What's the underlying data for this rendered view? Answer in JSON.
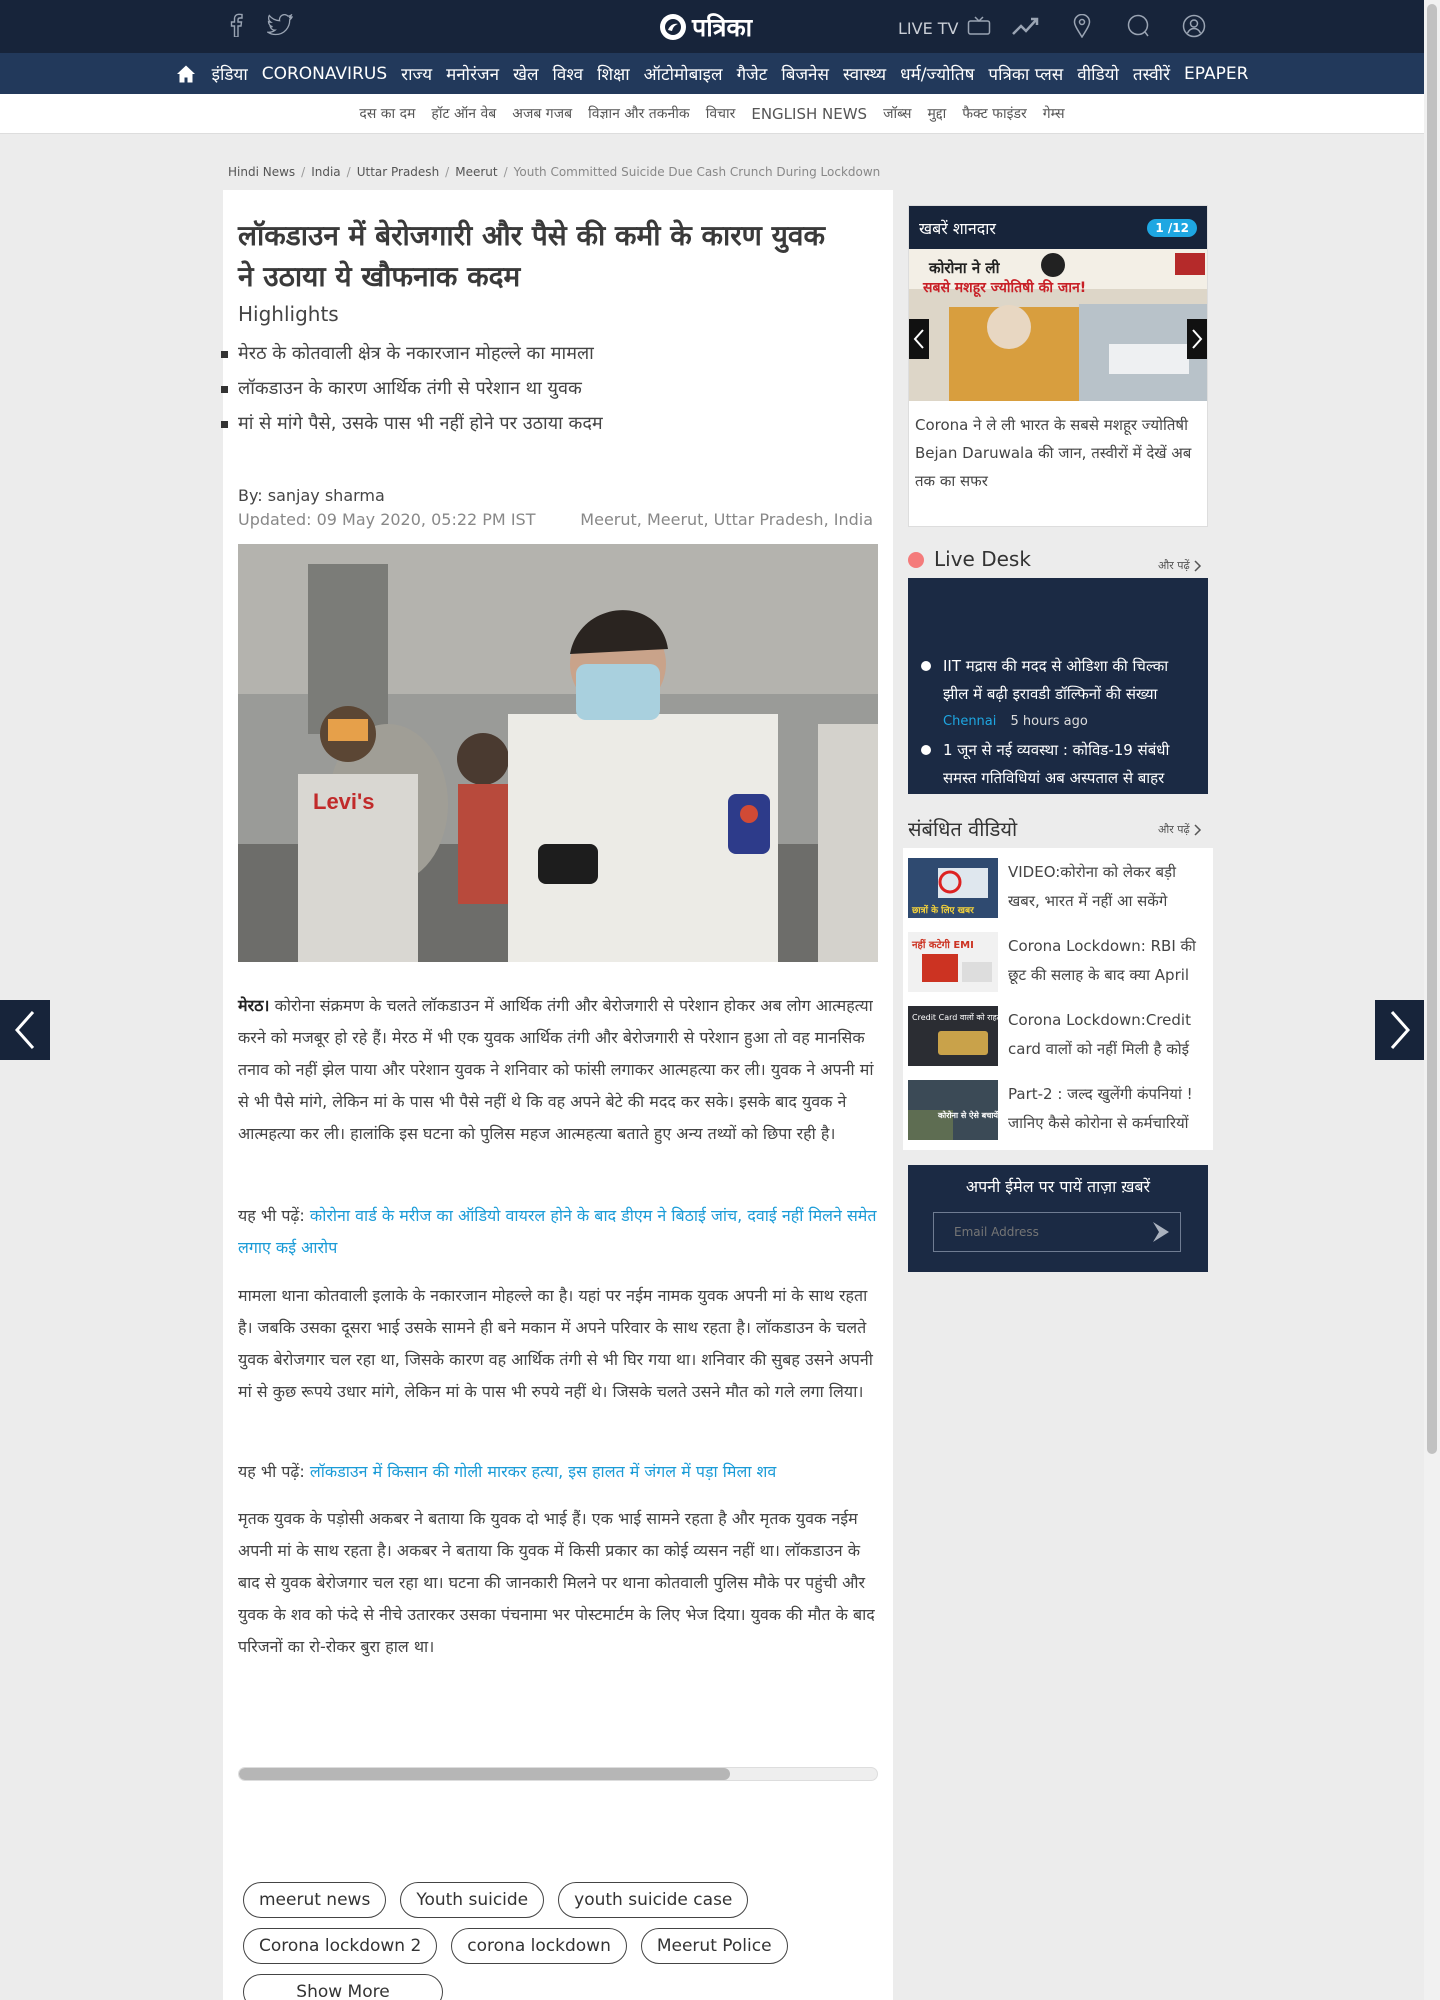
{
  "header": {
    "logo_text": "पत्रिका",
    "live_tv": "LIVE TV",
    "social_icons": [
      "facebook-icon",
      "twitter-icon"
    ],
    "right_icons": [
      "trending-icon",
      "location-pin-icon",
      "search-icon",
      "user-icon"
    ]
  },
  "main_nav": {
    "items": [
      "इंडिया",
      "CORONAVIRUS",
      "राज्य",
      "मनोरंजन",
      "खेल",
      "विश्व",
      "शिक्षा",
      "ऑटोमोबाइल",
      "गैजेट",
      "बिजनेस",
      "स्वास्थ्य",
      "धर्म/ज्योतिष",
      "पत्रिका प्लस",
      "वीडियो",
      "तस्वीरें",
      "EPAPER"
    ]
  },
  "sub_nav": {
    "items": [
      "दस का दम",
      "हॉट ऑन वेब",
      "अजब गजब",
      "विज्ञान और तकनीक",
      "विचार",
      "ENGLISH NEWS",
      "जॉब्स",
      "मुद्दा",
      "फैक्ट फाइंडर",
      "गेम्स"
    ]
  },
  "breadcrumb": {
    "items": [
      "Hindi News",
      "India",
      "Uttar Pradesh",
      "Meerut"
    ],
    "current": "Youth Committed Suicide Due Cash Crunch During Lockdown"
  },
  "article": {
    "headline": "लॉकडाउन में बेरोजगारी और पैसे की कमी के कारण युवक ने उठाया ये खौफनाक कदम",
    "highlights_title": "Highlights",
    "highlights": [
      "मेरठ के कोतवाली क्षेत्र के नकारजान मोहल्ले का मामला",
      "लॉकडाउन के कारण आर्थिक तंगी से परेशान था युवक",
      "मां से मांगे पैसे, उसके पास भी नहीं होने पर उठाया कदम"
    ],
    "byline": "By: sanjay sharma",
    "updated": "Updated: 09 May 2020, 05:22 PM IST",
    "location": "Meerut, Meerut, Uttar Pradesh, India",
    "p1_lead": "मेरठ।",
    "p1": " कोरोना संक्रमण के चलते लॉकडाउन में आर्थिक तंगी और बेरोजगारी से परेशान होकर अब लोग आत्महत्या करने को मजबूर हो रहे हैं। मेरठ में भी एक युवक आर्थिक तंगी और बेरोजगारी से परेशान हुआ तो वह मानसिक तनाव को नहीं झेल पाया और परेशान युवक ने शनिवार को फांसी लगाकर आत्महत्या कर ली। युवक ने अपनी मां से भी पैसे मांगे, लेकिन मां के पास भी पैसे नहीं थे कि वह अपने बेटे की मदद कर सके। इसके बाद युवक ने आत्महत्या कर ली। हालांकि इस घटना को पुलिस महज आत्महत्या बताते हुए अन्य तथ्यों को छिपा रही है।",
    "also_read_label": "यह भी पढ़ें:",
    "also_read_1": "कोरोना वार्ड के मरीज का ऑडियो वायरल होने के बाद डीएम ने बिठाई जांच, दवाई नहीं मिलने समेत लगाए कई आरोप",
    "p2": "मामला थाना कोतवाली इलाके के नकारजान मोहल्ले का है। यहां पर नईम नामक युवक अपनी मां के साथ रहता है। जबकि उसका दूसरा भाई उसके सामने ही बने मकान में अपने परिवार के साथ रहता है। लॉकडाउन के चलते युवक बेरोजगार चल रहा था, जिसके कारण वह आर्थिक तंगी से भी घिर गया था। शनिवार की सुबह उसने अपनी मां से कुछ रूपये उधार मांगे, लेकिन मां के पास भी रुपये नहीं थे। जिसके चलते उसने मौत को गले लगा लिया।",
    "also_read_2": "लॉकडाउन में किसान की गोली मारकर हत्या, इस हालत में जंगल में पड़ा मिला शव",
    "p3": "मृतक युवक के पड़ोसी अकबर ने बताया कि युवक दो भाई हैं। एक भाई सामने रहता है और मृतक युवक नईम अपनी मां के साथ रहता है। अकबर ने बताया कि युवक में किसी प्रकार का कोई व्यसन नहीं था। लॉकडाउन के बाद से युवक बेरोजगार चल रहा था। घटना की जानकारी मिलने पर थाना कोतवाली पुलिस मौके पर पहुंची और युवक के शव को फंदे से नीचे उतारकर उसका पंचनामा भर पोस्टमार्टम के लिए भेज दिया। युवक की मौत के बाद परिजनों का रो-रोकर बुरा हाल था।",
    "read_progress": 0.77,
    "tags": [
      "meerut news",
      "Youth suicide",
      "youth suicide case",
      "Corona lockdown 2",
      "corona lockdown",
      "Meerut Police"
    ],
    "show_more": "Show More"
  },
  "sidebar": {
    "khabar_title": "खबरें शानदार",
    "khabar_counter": "1 /12",
    "khabar_img_line1": "कोरोना ने ली",
    "khabar_img_line2": "सबसे मशहूर ज्योतिषी की जान!",
    "khabar_caption": "Corona ने ले ली भारत के सबसे मशहूर ज्योतिषी Bejan Daruwala की जान, तस्वीरों में देखें अब तक का सफर",
    "live_desk_title": "Live Desk",
    "more_label": "और पढ़ें",
    "live_items": [
      {
        "text": "IIT मद्रास की मदद से ओडिशा की चिल्का झील में बढ़ी इरावडी डॉल्फिनों की संख्या",
        "city": "Chennai",
        "time": "5 hours ago"
      },
      {
        "text": "1 जून से नई व्यवस्था : कोविड-19 संबंधी समस्त गतिविधियां अब अस्पताल से बाहर"
      }
    ],
    "videos_title": "संबंधित वीडियो",
    "videos": [
      {
        "title": "VIDEO:कोरोना को लेकर बड़ी खबर, भारत में नहीं आ सकेंगे",
        "thumb_text": "छात्रों के लिए खबर"
      },
      {
        "title": "Corona Lockdown: RBI की छूट की सलाह के बाद क्या April",
        "thumb_text": "नहीं कटेगी EMI"
      },
      {
        "title": "Corona Lockdown:Credit card वालों को नहीं मिली है कोई",
        "thumb_text": "Credit Card वालों को राहत नहीं"
      },
      {
        "title": "Part-2 : जल्द खुलेंगी कंपनियां ! जानिए कैसे कोरोना से कर्मचारियों",
        "thumb_text": "कोरोना से ऐसे बचायेंगी कंपनियां"
      }
    ],
    "email_title": "अपनी ईमेल पर पायें ताज़ा ख़बरें",
    "email_placeholder": "Email Address"
  },
  "colors": {
    "topbar": "#17243a",
    "nav": "#22395b",
    "link": "#1a9bd7",
    "accent": "#1ea7e2"
  }
}
